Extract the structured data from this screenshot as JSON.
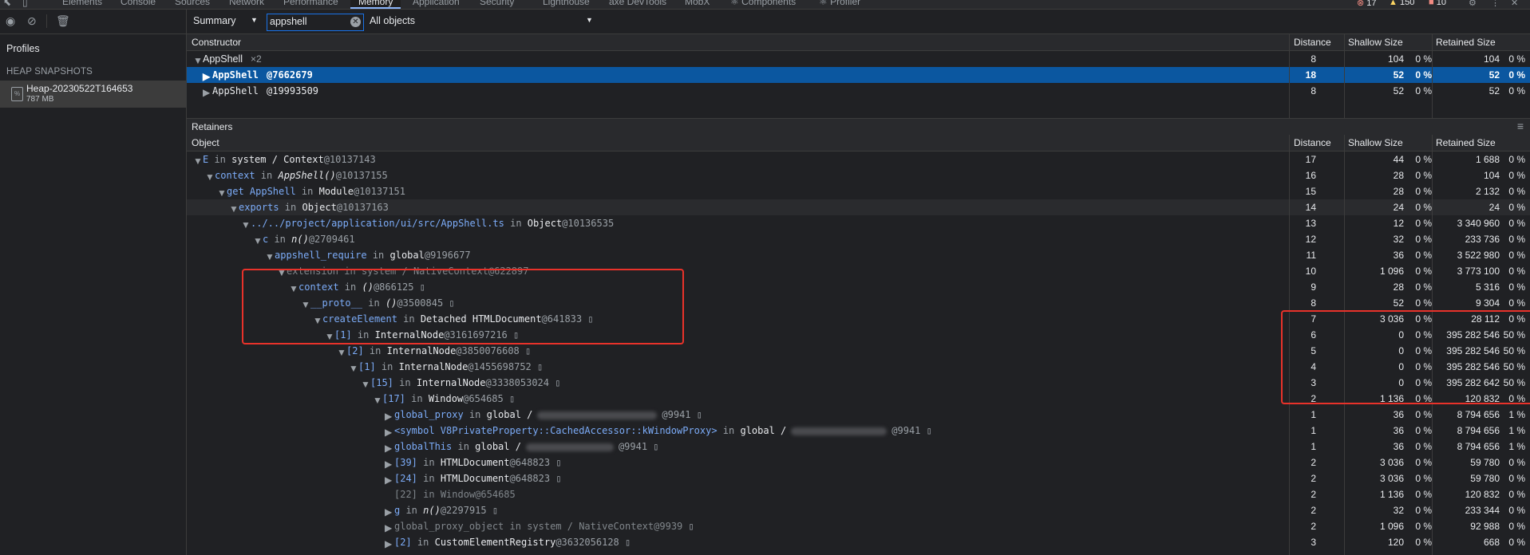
{
  "tabs": {
    "items": [
      "Elements",
      "Console",
      "Sources",
      "Network",
      "Performance",
      "Memory",
      "Application",
      "Security",
      "Lighthouse",
      "axe DevTools",
      "MobX",
      "Components",
      "Profiler"
    ],
    "active": "Memory",
    "errors": "17",
    "warnings": "150",
    "issues": "10"
  },
  "left": {
    "profiles_label": "Profiles",
    "heap_header": "HEAP SNAPSHOTS",
    "snapshot_name": "Heap-20230522T164653",
    "snapshot_size": "787 MB"
  },
  "toolbar": {
    "view": "Summary",
    "filter_value": "appshell",
    "objects": "All objects"
  },
  "constructor_grid": {
    "headers": {
      "name": "Constructor",
      "distance": "Distance",
      "shallow": "Shallow Size",
      "retained": "Retained Size"
    },
    "group": {
      "name": "AppShell",
      "count": "×2",
      "distance": "8",
      "shallow": "104",
      "shallow_pct": "0 %",
      "retained": "104",
      "retained_pct": "0 %"
    },
    "rows": [
      {
        "name": "AppShell",
        "id": "@7662679",
        "distance": "18",
        "shallow": "52",
        "shallow_pct": "0 %",
        "retained": "52",
        "retained_pct": "0 %"
      },
      {
        "name": "AppShell",
        "id": "@19993509",
        "distance": "8",
        "shallow": "52",
        "shallow_pct": "0 %",
        "retained": "52",
        "retained_pct": "0 %"
      }
    ]
  },
  "retainers": {
    "title": "Retainers",
    "menu_icon": "≡",
    "headers": {
      "name": "Object",
      "distance": "Distance",
      "shallow": "Shallow Size",
      "retained": "Retained Size"
    },
    "rows": [
      {
        "e": "E",
        "in": "system / Context",
        "id": "@10137143",
        "d": "17",
        "s": "44",
        "sp": "0 %",
        "r": "1 688",
        "rp": "0 %"
      },
      {
        "e": "context",
        "in": "AppShell()",
        "id": "@10137155",
        "d": "16",
        "s": "28",
        "sp": "0 %",
        "r": "104",
        "rp": "0 %"
      },
      {
        "e": "get AppShell",
        "in": "Module",
        "id": "@10137151",
        "d": "15",
        "s": "28",
        "sp": "0 %",
        "r": "2 132",
        "rp": "0 %"
      },
      {
        "e": "exports",
        "in": "Object",
        "id": "@10137163",
        "d": "14",
        "s": "24",
        "sp": "0 %",
        "r": "24",
        "rp": "0 %"
      },
      {
        "e": "../../project/application/ui/src/AppShell.ts",
        "in": "Object",
        "id": "@10136535",
        "d": "13",
        "s": "12",
        "sp": "0 %",
        "r": "3 340 960",
        "rp": "0 %"
      },
      {
        "e": "c",
        "in": "n()",
        "id": "@2709461",
        "d": "12",
        "s": "32",
        "sp": "0 %",
        "r": "233 736",
        "rp": "0 %"
      },
      {
        "e": "appshell_require",
        "in": "global",
        "id": "@9196677",
        "d": "11",
        "s": "36",
        "sp": "0 %",
        "r": "3 522 980",
        "rp": "0 %"
      },
      {
        "e": "extension",
        "in": "system / NativeContext",
        "id": "@622897",
        "d": "10",
        "s": "1 096",
        "sp": "0 %",
        "r": "3 773 100",
        "rp": "0 %"
      },
      {
        "e": "context",
        "in": "()",
        "id": "@866125",
        "d": "9",
        "s": "28",
        "sp": "0 %",
        "r": "5 316",
        "rp": "0 %"
      },
      {
        "e": "__proto__",
        "in": "()",
        "id": "@3500845",
        "d": "8",
        "s": "52",
        "sp": "0 %",
        "r": "9 304",
        "rp": "0 %"
      },
      {
        "e": "createElement",
        "in": "Detached HTMLDocument",
        "id": "@641833",
        "d": "7",
        "s": "3 036",
        "sp": "0 %",
        "r": "28 112",
        "rp": "0 %"
      },
      {
        "e": "[1]",
        "in": "InternalNode",
        "id": "@3161697216",
        "d": "6",
        "s": "0",
        "sp": "0 %",
        "r": "395 282 546",
        "rp": "50 %"
      },
      {
        "e": "[2]",
        "in": "InternalNode",
        "id": "@3850076608",
        "d": "5",
        "s": "0",
        "sp": "0 %",
        "r": "395 282 546",
        "rp": "50 %"
      },
      {
        "e": "[1]",
        "in": "InternalNode",
        "id": "@1455698752",
        "d": "4",
        "s": "0",
        "sp": "0 %",
        "r": "395 282 546",
        "rp": "50 %"
      },
      {
        "e": "[15]",
        "in": "InternalNode",
        "id": "@3338053024",
        "d": "3",
        "s": "0",
        "sp": "0 %",
        "r": "395 282 642",
        "rp": "50 %"
      },
      {
        "e": "[17]",
        "in": "Window",
        "id": "@654685",
        "d": "2",
        "s": "1 136",
        "sp": "0 %",
        "r": "120 832",
        "rp": "0 %"
      },
      {
        "e": "global_proxy",
        "in": "global /",
        "id": "@9941",
        "d": "1",
        "s": "36",
        "sp": "0 %",
        "r": "8 794 656",
        "rp": "1 %"
      },
      {
        "e": "<symbol V8PrivateProperty::CachedAccessor::kWindowProxy>",
        "in": "global /",
        "id": "@9941",
        "d": "1",
        "s": "36",
        "sp": "0 %",
        "r": "8 794 656",
        "rp": "1 %"
      },
      {
        "e": "globalThis",
        "in": "global /",
        "id": "@9941",
        "d": "1",
        "s": "36",
        "sp": "0 %",
        "r": "8 794 656",
        "rp": "1 %"
      },
      {
        "e": "[39]",
        "in": "HTMLDocument",
        "id": "@648823",
        "d": "2",
        "s": "3 036",
        "sp": "0 %",
        "r": "59 780",
        "rp": "0 %"
      },
      {
        "e": "[24]",
        "in": "HTMLDocument",
        "id": "@648823",
        "d": "2",
        "s": "3 036",
        "sp": "0 %",
        "r": "59 780",
        "rp": "0 %"
      },
      {
        "e": "[22]",
        "in": "Window",
        "id": "@654685",
        "d": "2",
        "s": "1 136",
        "sp": "0 %",
        "r": "120 832",
        "rp": "0 %"
      },
      {
        "e": "g",
        "in": "n()",
        "id": "@2297915",
        "d": "2",
        "s": "32",
        "sp": "0 %",
        "r": "233 344",
        "rp": "0 %"
      },
      {
        "e": "global_proxy_object",
        "in": "system / NativeContext",
        "id": "@9939",
        "d": "2",
        "s": "1 096",
        "sp": "0 %",
        "r": "92 988",
        "rp": "0 %"
      },
      {
        "e": "[2]",
        "in": "CustomElementRegistry",
        "id": "@3632056128",
        "d": "3",
        "s": "120",
        "sp": "0 %",
        "r": "668",
        "rp": "0 %"
      }
    ]
  },
  "colors": {
    "accent": "#8ab4f8",
    "selected_row": "#0b57a0",
    "annotation": "#e8322a"
  }
}
